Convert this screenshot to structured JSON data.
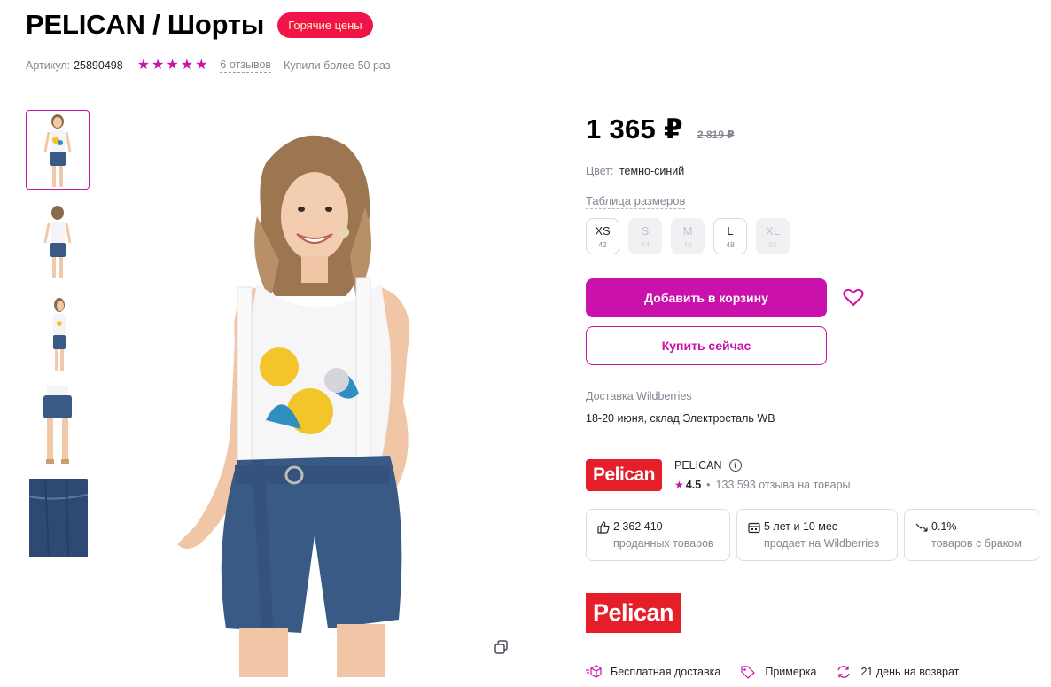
{
  "header": {
    "brand_title": "PELICAN / Шорты",
    "hot_badge": "Горячие цены",
    "sku_label": "Артикул:",
    "sku_value": "25890498",
    "rating_stars": 5,
    "reviews_link": "6 отзывов",
    "bought_text": "Купили более 50 раз"
  },
  "gallery": {
    "thumbnails": [
      "thumb-front",
      "thumb-back",
      "thumb-side",
      "thumb-shorts-detail",
      "thumb-fabric"
    ],
    "active_index": 0
  },
  "product": {
    "price": "1 365 ₽",
    "old_price": "2 819 ₽",
    "color_label": "Цвет:",
    "color_value": "темно-синий",
    "size_table_link": "Таблица размеров",
    "sizes": [
      {
        "size": "XS",
        "ru": "42",
        "available": true
      },
      {
        "size": "S",
        "ru": "44",
        "available": false
      },
      {
        "size": "M",
        "ru": "46",
        "available": false
      },
      {
        "size": "L",
        "ru": "48",
        "available": true
      },
      {
        "size": "XL",
        "ru": "50",
        "available": false
      }
    ],
    "add_to_cart": "Добавить в корзину",
    "buy_now": "Купить сейчас",
    "delivery_label": "Доставка Wildberries",
    "delivery_value": "18-20 июня, склад Электросталь WB"
  },
  "seller": {
    "logo_text": "Pelican",
    "name": "PELICAN",
    "rating": "4.5",
    "reviews": "133 593 отзыва на товары",
    "stats": [
      {
        "value": "2 362 410",
        "label": "проданных товаров",
        "icon": "thumbs-up-icon"
      },
      {
        "value": "5 лет и 10 мес",
        "label": "продает на Wildberries",
        "icon": "calendar-icon"
      },
      {
        "value": "0.1%",
        "label": "товаров с браком",
        "icon": "trend-down-icon"
      }
    ],
    "brand_logo_text": "Pelican"
  },
  "features": [
    {
      "label": "Бесплатная доставка",
      "icon": "box-icon"
    },
    {
      "label": "Примерка",
      "icon": "tag-icon"
    },
    {
      "label": "21 день на возврат",
      "icon": "refresh-icon"
    }
  ],
  "colors": {
    "accent": "#cb11ab",
    "hot": "#f0144b",
    "brand_red": "#e61e2a",
    "muted": "#868695"
  }
}
